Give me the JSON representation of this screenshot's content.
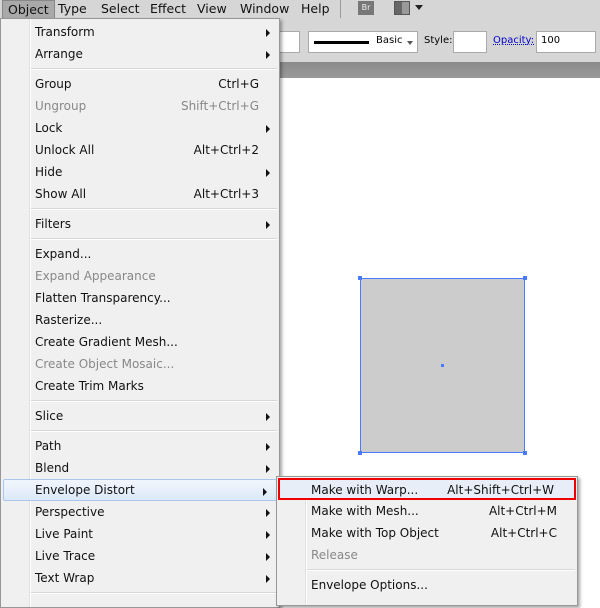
{
  "menubar": {
    "items": [
      "Object",
      "Type",
      "Select",
      "Effect",
      "View",
      "Window",
      "Help"
    ],
    "br": "Br"
  },
  "control": {
    "stroke_profile": "Basic",
    "style_label": "Style:",
    "opacity_label": "Opacity:",
    "opacity_value": "100"
  },
  "object_menu": [
    {
      "label": "Transform",
      "sub": true
    },
    {
      "label": "Arrange",
      "sub": true
    },
    {
      "sep": true
    },
    {
      "label": "Group",
      "shortcut": "Ctrl+G"
    },
    {
      "label": "Ungroup",
      "shortcut": "Shift+Ctrl+G",
      "disabled": true
    },
    {
      "label": "Lock",
      "sub": true
    },
    {
      "label": "Unlock All",
      "shortcut": "Alt+Ctrl+2"
    },
    {
      "label": "Hide",
      "sub": true
    },
    {
      "label": "Show All",
      "shortcut": "Alt+Ctrl+3"
    },
    {
      "sep": true
    },
    {
      "label": "Filters",
      "sub": true
    },
    {
      "sep": true
    },
    {
      "label": "Expand..."
    },
    {
      "label": "Expand Appearance",
      "disabled": true
    },
    {
      "label": "Flatten Transparency..."
    },
    {
      "label": "Rasterize..."
    },
    {
      "label": "Create Gradient Mesh..."
    },
    {
      "label": "Create Object Mosaic...",
      "disabled": true
    },
    {
      "label": "Create Trim Marks"
    },
    {
      "sep": true
    },
    {
      "label": "Slice",
      "sub": true
    },
    {
      "sep": true
    },
    {
      "label": "Path",
      "sub": true
    },
    {
      "label": "Blend",
      "sub": true
    },
    {
      "label": "Envelope Distort",
      "sub": true,
      "highlighted": true
    },
    {
      "label": "Perspective",
      "sub": true
    },
    {
      "label": "Live Paint",
      "sub": true
    },
    {
      "label": "Live Trace",
      "sub": true
    },
    {
      "label": "Text Wrap",
      "sub": true
    },
    {
      "sep": true
    }
  ],
  "envelope_submenu": [
    {
      "label": "Make with Warp...",
      "shortcut": "Alt+Shift+Ctrl+W",
      "selected": true
    },
    {
      "label": "Make with Mesh...",
      "shortcut": "Alt+Ctrl+M"
    },
    {
      "label": "Make with Top Object",
      "shortcut": "Alt+Ctrl+C"
    },
    {
      "label": "Release",
      "disabled": true
    },
    {
      "sep": true
    },
    {
      "label": "Envelope Options..."
    }
  ],
  "colors": {
    "selection": "#4a7bff",
    "rect_fill": "#cccccc",
    "highlight_border": "#e00000"
  }
}
